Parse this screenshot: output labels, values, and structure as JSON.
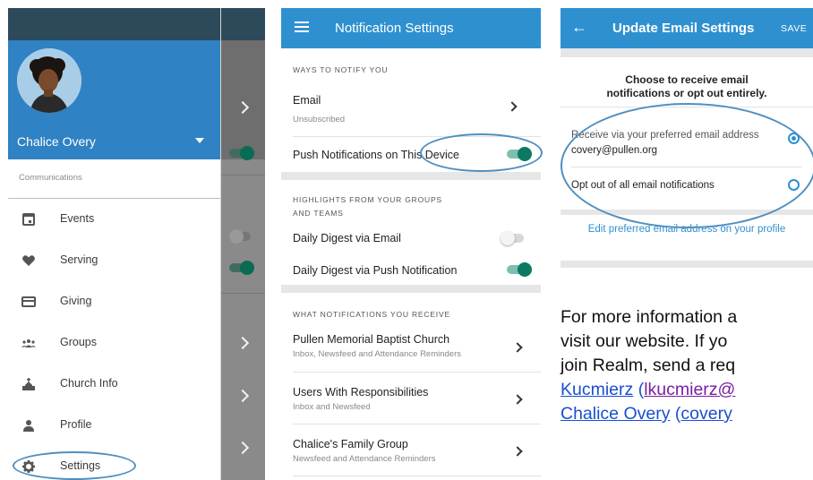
{
  "colors": {
    "header_blue": "#2f90cf",
    "drawer_blue": "#2f82c3",
    "teal": "#0c7a60",
    "annotation": "#4f8fc0",
    "link": "#1a4fd0"
  },
  "drawer": {
    "user_name": "Chalice Overy",
    "section_label": "Communications",
    "items": [
      {
        "label": "Events",
        "icon": "calendar-icon"
      },
      {
        "label": "Serving",
        "icon": "heart-icon"
      },
      {
        "label": "Giving",
        "icon": "credit-card-icon"
      },
      {
        "label": "Groups",
        "icon": "groups-icon"
      },
      {
        "label": "Church Info",
        "icon": "church-icon"
      },
      {
        "label": "Profile",
        "icon": "person-icon"
      },
      {
        "label": "Settings",
        "icon": "gear-icon"
      }
    ]
  },
  "notifications": {
    "title": "Notification Settings",
    "section_ways": "WAYS TO NOTIFY YOU",
    "email": {
      "title": "Email",
      "status": "Unsubscribed"
    },
    "push_device": {
      "label": "Push Notifications on This Device",
      "on": true
    },
    "section_highlights_1": "HIGHLIGHTS FROM YOUR GROUPS",
    "section_highlights_2": "AND TEAMS",
    "digest_email": {
      "label": "Daily Digest via Email",
      "on": false
    },
    "digest_push": {
      "label": "Daily Digest via Push Notification",
      "on": true
    },
    "section_what": "WHAT NOTIFICATIONS YOU RECEIVE",
    "groups": [
      {
        "title": "Pullen Memorial Baptist Church",
        "subtitle": "Inbox, Newsfeed and Attendance Reminders"
      },
      {
        "title": "Users With Responsibilities",
        "subtitle": "Inbox and Newsfeed"
      },
      {
        "title": "Chalice's Family Group",
        "subtitle": "Newsfeed and Attendance Reminders"
      }
    ]
  },
  "email_settings": {
    "back_icon": "arrow-left-icon",
    "title": "Update Email Settings",
    "save_label": "SAVE",
    "intro_line1": "Choose to receive email",
    "intro_line2": "notifications or opt out entirely.",
    "option_receive": {
      "label": "Receive via your preferred email address",
      "address": "covery@pullen.org",
      "selected": true
    },
    "option_optout": {
      "label": "Opt out of all email notifications",
      "selected": false
    },
    "edit_link": "Edit preferred email address on your profile"
  },
  "document": {
    "line1": "For more information a",
    "line2": "visit our website.  If yo",
    "line3": "join Realm, send a req",
    "line4_link": "Kucmierz",
    "line4_open": " (",
    "line4_email": "lkucmierz@",
    "line5_link": "Chalice Overy",
    "line5_open": " (",
    "line5_email": "covery"
  }
}
